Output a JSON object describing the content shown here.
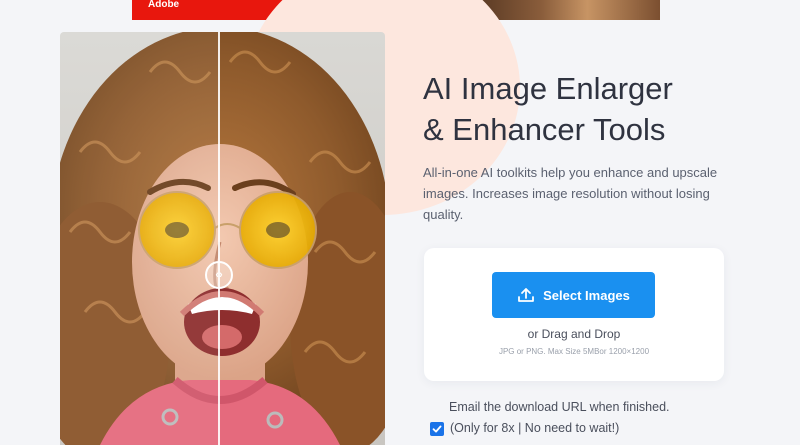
{
  "ad": {
    "brand": "Adobe"
  },
  "hero": {
    "title_line1": "AI Image Enlarger",
    "title_line2": "& Enhancer Tools",
    "description": "All-in-one AI toolkits help you enhance and upscale images. Increases image resolution without losing quality."
  },
  "upload": {
    "button_label": "Select Images",
    "button_icon": "upload-icon",
    "drag_text": "or Drag and Drop",
    "hint": "JPG or PNG. Max Size 5MBor 1200×1200"
  },
  "email_option": {
    "label": "Email the download URL when finished.",
    "checkbox_label": "(Only for 8x | No need to wait!)",
    "checked": true
  },
  "compare": {
    "handle_icon": "left-right-arrows-icon"
  },
  "colors": {
    "primary": "#1a90f0",
    "checkbox": "#1a73e8",
    "ad_red": "#e8170d",
    "blob": "#fde7de"
  }
}
